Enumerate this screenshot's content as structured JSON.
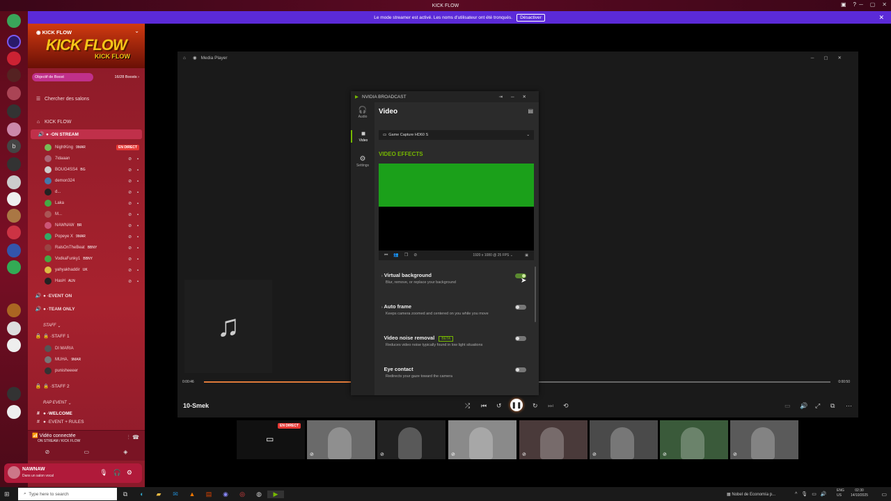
{
  "app": {
    "title": "KICK FLOW"
  },
  "banner": {
    "text": "Le mode streamer est activé. Les noms d'utilisateur ont été tronqués.",
    "button": "Désactiver"
  },
  "server": {
    "name": "KICK FLOW",
    "logo_text": "KICK FLOW",
    "boost_label": "Objectif de Boost",
    "boost_count": "16/28 Boosts ›"
  },
  "channels": {
    "search": "Chercher des salons",
    "category": "KICK FLOW",
    "on_stream": "ON STREAM",
    "event_on": "EVENT ON",
    "team_only": "TEAM ONLY",
    "staff_cat": "STAFF",
    "staff1": "STAFF 1",
    "staff2": "STAFF 2",
    "rap_event": "RAP EVENT",
    "welcome": "WELCOME",
    "event_rules": "EVENT + RULES"
  },
  "voice_users": [
    {
      "name": "NightKing",
      "tag": "9MAR",
      "live": "EN DIRECT",
      "color": "#7b5"
    },
    {
      "name": "7idaaan",
      "tag": "",
      "live": "",
      "color": "#a67"
    },
    {
      "name": "BOUG4SS4",
      "tag": "BG",
      "live": "",
      "color": "#ccc"
    },
    {
      "name": "demon324",
      "tag": "",
      "live": "",
      "color": "#47a"
    },
    {
      "name": "d...",
      "tag": "",
      "live": "",
      "color": "#222"
    },
    {
      "name": "Laka",
      "tag": "",
      "live": "",
      "color": "#4a4"
    },
    {
      "name": "M...",
      "tag": "",
      "live": "",
      "color": "#a55"
    },
    {
      "name": "NAWNAW",
      "tag": "BR",
      "live": "",
      "color": "#c57"
    },
    {
      "name": "Popeye X",
      "tag": "9MAR",
      "live": "",
      "color": "#3a6"
    },
    {
      "name": "RalsOnTheBeat",
      "tag": "BBNY",
      "live": "",
      "color": "#944"
    },
    {
      "name": "VodkaFunky1",
      "tag": "BBNY",
      "live": "",
      "color": "#4a4"
    },
    {
      "name": "yahyakhaddir",
      "tag": "UK",
      "live": "",
      "color": "#db4"
    },
    {
      "name": "HasH",
      "tag": "ALN",
      "live": "",
      "color": "#222"
    }
  ],
  "staff_users": [
    {
      "name": "DI MARIA",
      "tag": "",
      "color": "#555"
    },
    {
      "name": "MUHA.",
      "tag": "9MAR",
      "color": "#777"
    },
    {
      "name": "punisheeeer",
      "tag": "",
      "color": "#333"
    }
  ],
  "voice": {
    "status": "Vidéo connectée",
    "channel": "ON STREAM / KICK FLOW"
  },
  "user": {
    "name": "NAWNAW",
    "status": "Dans un salon vocal"
  },
  "player": {
    "title": "Media Player",
    "track": "10-Smek",
    "elapsed": "0:00:46",
    "duration": "0:00:50",
    "progress": 0.24
  },
  "nvidia": {
    "title": "NVIDIA BROADCAST",
    "section": "Video",
    "tabs": [
      {
        "label": "Audio"
      },
      {
        "label": "Video"
      },
      {
        "label": "Settings"
      }
    ],
    "device": "Game Capture HD60 S",
    "effects_header": "VIDEO EFFECTS",
    "resolution": "1920 x 1080 @ 25 FPS",
    "effects": [
      {
        "title": "Virtual background",
        "desc": "Blur, remove, or replace your background",
        "on": true,
        "beta": ""
      },
      {
        "title": "Auto frame",
        "desc": "Keeps camera zoomed and centered on you while you move",
        "on": false,
        "beta": ""
      },
      {
        "title": "Video noise removal",
        "desc": "Reduces video noise typically found in low light situations",
        "on": false,
        "beta": "BETA"
      },
      {
        "title": "Eye contact",
        "desc": "Redirects your gaze toward the camera",
        "on": false,
        "beta": ""
      }
    ]
  },
  "cams": {
    "live_label": "EN DIRECT"
  },
  "taskbar": {
    "search_placeholder": "Type here to search",
    "news": "Nobel de Economía p...",
    "lang": "ENG",
    "region": "US",
    "time": "02:30",
    "date": "14/10/2025"
  },
  "colors": {
    "accent_green": "#76b900",
    "banner": "#5b2ad8",
    "live_red": "#e53935"
  }
}
